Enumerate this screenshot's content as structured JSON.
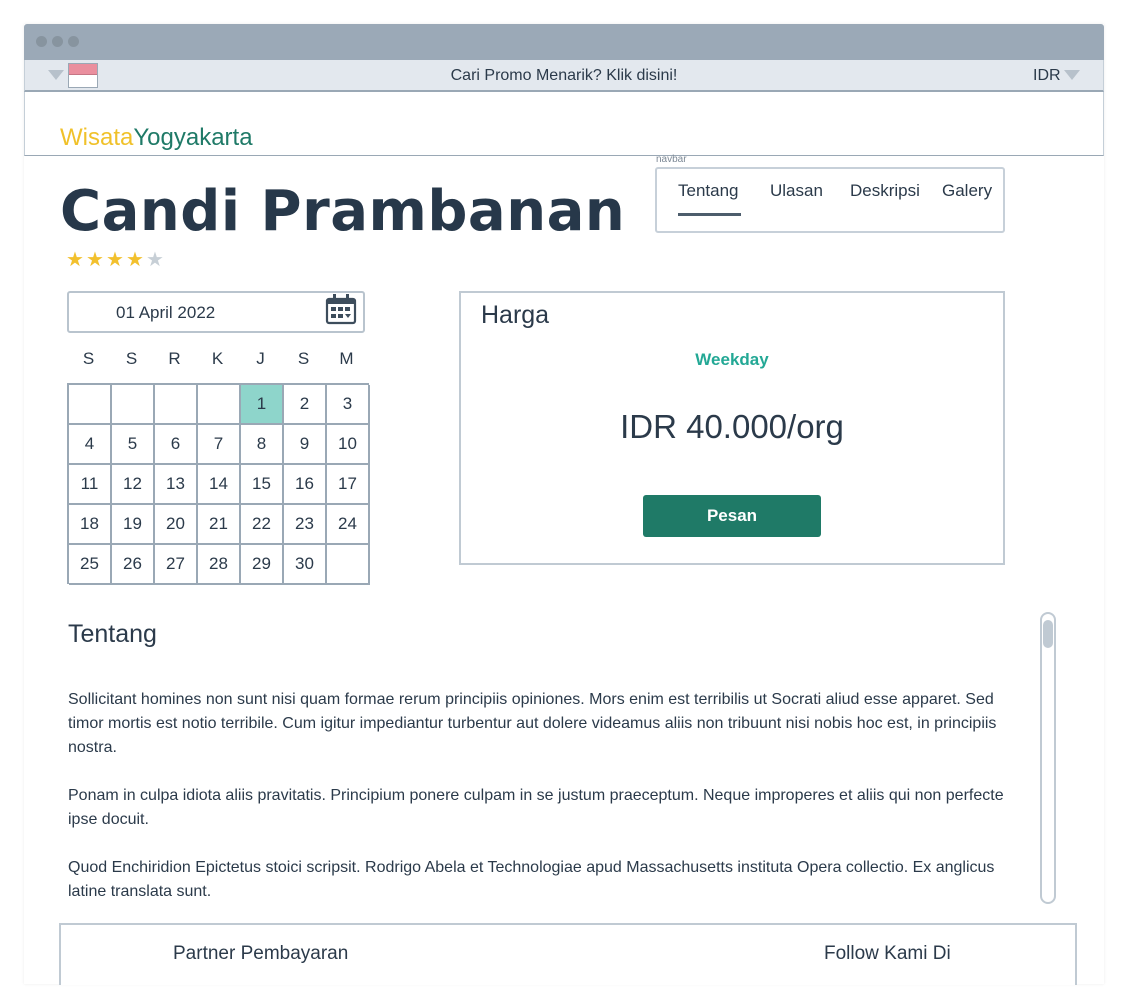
{
  "promo": {
    "text": "Cari Promo Menarik? Klik disini!",
    "currency": "IDR"
  },
  "brand": {
    "part1": "Wisata",
    "part2": "Yogyakarta"
  },
  "navbar": {
    "caption": "navbar",
    "items": [
      {
        "label": "Tentang"
      },
      {
        "label": "Ulasan"
      },
      {
        "label": "Deskripsi"
      },
      {
        "label": "Galery"
      }
    ]
  },
  "title": "Candi Prambanan",
  "rating": {
    "value": 4,
    "max": 5,
    "star_glyph": "★"
  },
  "calendar": {
    "selected_date": "01 April 2022",
    "weekdays": [
      "S",
      "S",
      "R",
      "K",
      "J",
      "S",
      "M"
    ],
    "days": [
      "",
      "",
      "",
      "",
      "1",
      "2",
      "3",
      "4",
      "5",
      "6",
      "7",
      "8",
      "9",
      "10",
      "11",
      "12",
      "13",
      "14",
      "15",
      "16",
      "17",
      "18",
      "19",
      "20",
      "21",
      "22",
      "23",
      "24",
      "25",
      "26",
      "27",
      "28",
      "29",
      "30",
      ""
    ],
    "selected_day": "1"
  },
  "price": {
    "title": "Harga",
    "subtitle": "Weekday",
    "value": "IDR 40.000/org",
    "button": "Pesan"
  },
  "about": {
    "title": "Tentang",
    "paragraphs": [
      "Sollicitant homines non sunt nisi quam formae rerum principiis opiniones. Mors enim est terribilis ut Socrati aliud esse apparet. Sed timor mortis est notio terribile. Cum igitur impediantur turbentur aut dolere videamus aliis non tribuunt nisi nobis hoc est, in principiis nostra.",
      "Ponam in culpa idiota aliis pravitatis. Principium ponere culpam in se justum praeceptum. Neque improperes et aliis qui non perfecte ipse docuit.",
      "Quod Enchiridion Epictetus stoici scripsit. Rodrigo Abela et Technologiae apud Massachusetts instituta Opera collectio. Ex anglicus latine translata sunt."
    ]
  },
  "footer": {
    "left": "Partner Pembayaran",
    "right": "Follow Kami Di"
  },
  "colors": {
    "brand_yellow": "#f0c12a",
    "brand_green": "#1f7a67",
    "accent_teal": "#23a895",
    "selected_day_bg": "#8ed5cb"
  }
}
